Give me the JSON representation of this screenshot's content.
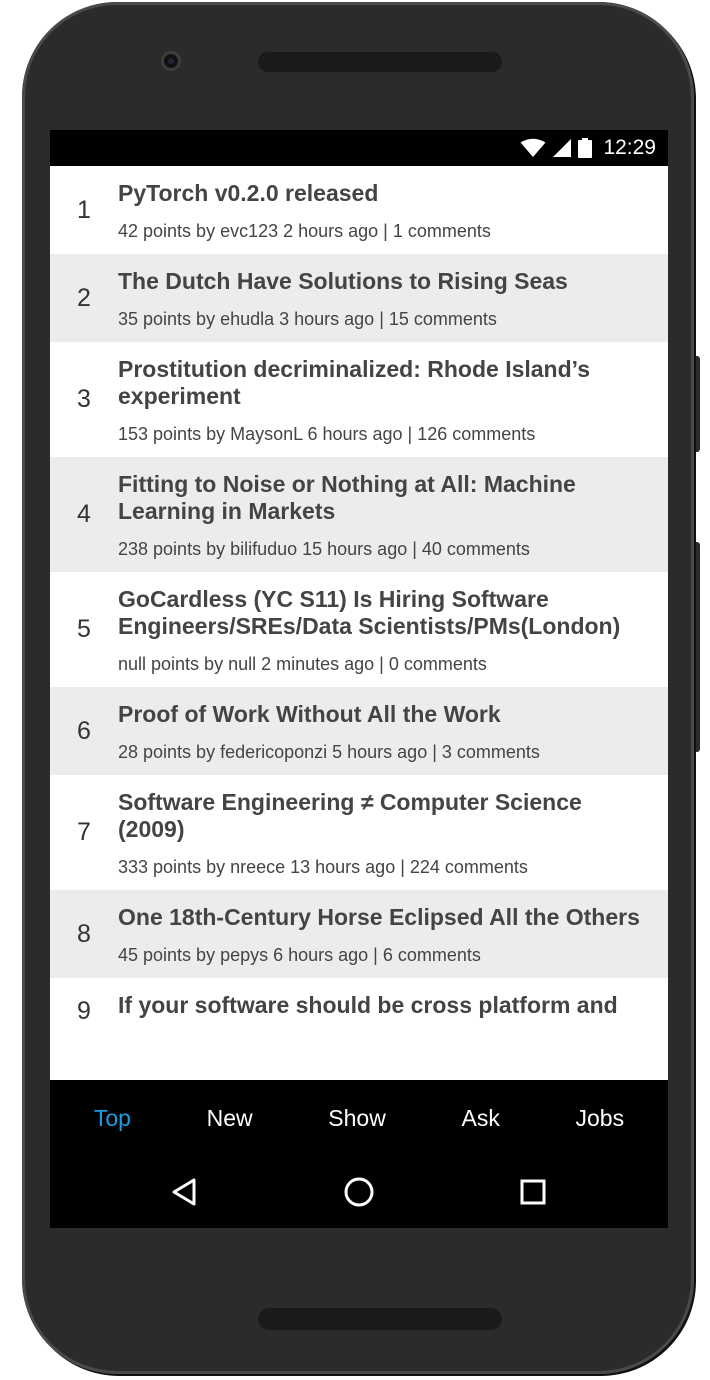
{
  "status_bar": {
    "time": "12:29",
    "icons": [
      "wifi-icon",
      "signal-icon",
      "battery-icon"
    ]
  },
  "stories": [
    {
      "rank": "1",
      "title": "PyTorch v0.2.0 released",
      "meta": "42 points by evc123 2 hours ago | 1 comments"
    },
    {
      "rank": "2",
      "title": "The Dutch Have Solutions to Rising Seas",
      "meta": "35 points by ehudla 3 hours ago | 15 comments"
    },
    {
      "rank": "3",
      "title": "Prostitution decriminalized: Rhode Island’s experiment",
      "meta": "153 points by MaysonL 6 hours ago | 126 comments"
    },
    {
      "rank": "4",
      "title": "Fitting to Noise or Nothing at All: Machine Learning in Markets",
      "meta": "238 points by bilifuduo 15 hours ago | 40 comments"
    },
    {
      "rank": "5",
      "title": "GoCardless (YC S11) Is Hiring Software Engineers/SREs/Data Scientists/PMs(London)",
      "meta": "null points by null 2 minutes ago | 0 comments"
    },
    {
      "rank": "6",
      "title": "Proof of Work Without All the Work",
      "meta": "28 points by federicoponzi 5 hours ago | 3 comments"
    },
    {
      "rank": "7",
      "title": "Software Engineering ≠ Computer Science (2009)",
      "meta": "333 points by nreece 13 hours ago | 224 comments"
    },
    {
      "rank": "8",
      "title": "One 18th-Century Horse Eclipsed All the Others",
      "meta": "45 points by pepys 6 hours ago | 6 comments"
    },
    {
      "rank": "9",
      "title": "If your software should be cross platform and",
      "meta": ""
    }
  ],
  "tabs": [
    {
      "label": "Top",
      "active": true
    },
    {
      "label": "New",
      "active": false
    },
    {
      "label": "Show",
      "active": false
    },
    {
      "label": "Ask",
      "active": false
    },
    {
      "label": "Jobs",
      "active": false
    }
  ],
  "colors": {
    "active_tab": "#1a9ce2",
    "row_alt": "#ececec",
    "text": "#444444"
  }
}
